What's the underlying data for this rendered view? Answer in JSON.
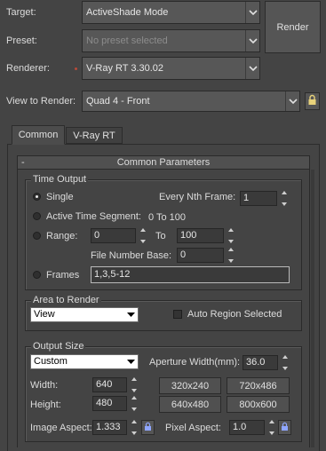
{
  "top": {
    "target_label": "Target:",
    "target_value": "ActiveShade Mode",
    "preset_label": "Preset:",
    "preset_value": "No preset selected",
    "renderer_label": "Renderer:",
    "renderer_value": "V-Ray RT 3.30.02",
    "view_label": "View to Render:",
    "view_value": "Quad 4 - Front",
    "render_button": "Render"
  },
  "tabs": [
    {
      "label": "Common"
    },
    {
      "label": "V-Ray RT"
    }
  ],
  "rollout": {
    "toggle": "-",
    "title": "Common Parameters"
  },
  "time_output": {
    "title": "Time Output",
    "single_label": "Single",
    "every_nth_label": "Every Nth Frame:",
    "every_nth_value": "1",
    "active_segment_label": "Active Time Segment:",
    "active_segment_range": "0 To 100",
    "range_label": "Range:",
    "range_from": "0",
    "range_to_label": "To",
    "range_to": "100",
    "file_number_base_label": "File Number Base:",
    "file_number_base_value": "0",
    "frames_label": "Frames",
    "frames_value": "1,3,5-12",
    "selected": "Single"
  },
  "area_to_render": {
    "title": "Area to Render",
    "value": "View",
    "auto_region_label": "Auto Region Selected",
    "auto_region_checked": false
  },
  "output_size": {
    "title": "Output Size",
    "preset_value": "Custom",
    "aperture_label": "Aperture Width(mm):",
    "aperture_value": "36.0",
    "width_label": "Width:",
    "width_value": "640",
    "height_label": "Height:",
    "height_value": "480",
    "presets": [
      "320x240",
      "720x486",
      "640x480",
      "800x600"
    ],
    "image_aspect_label": "Image Aspect:",
    "image_aspect_value": "1.333",
    "pixel_aspect_label": "Pixel Aspect:",
    "pixel_aspect_value": "1.0"
  },
  "colors": {
    "background": "#444444",
    "control": "#575757",
    "field": "#3a3a3a",
    "renderer_dot": "#b84a3a"
  }
}
